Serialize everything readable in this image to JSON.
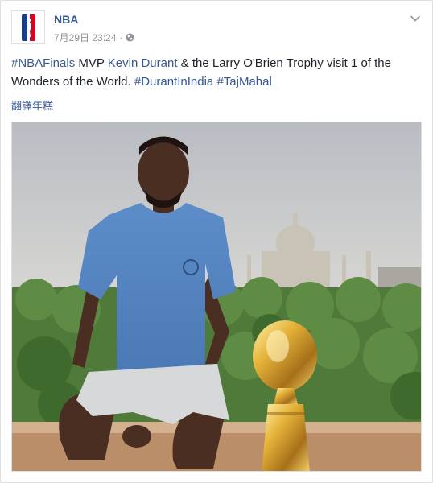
{
  "post": {
    "page_name": "NBA",
    "timestamp": "7月29日 23:24",
    "separator": "·",
    "privacy_icon": "globe-icon",
    "menu_icon": "chevron-down-icon",
    "translate_label": "翻譯年糕",
    "caption": {
      "hashtag_finals": "#NBAFinals",
      "text_mvp": " MVP ",
      "mention": "Kevin Durant",
      "text_mid": " & the Larry O'Brien Trophy visit 1 of the Wonders of the World. ",
      "hashtag_india": "#DurantInIndia",
      "text_space": " ",
      "hashtag_taj": "#TajMahal"
    }
  },
  "colors": {
    "link": "#365899",
    "text": "#1d2129",
    "meta": "#90949c",
    "nba_blue": "#17408b",
    "nba_red": "#c9082a"
  }
}
